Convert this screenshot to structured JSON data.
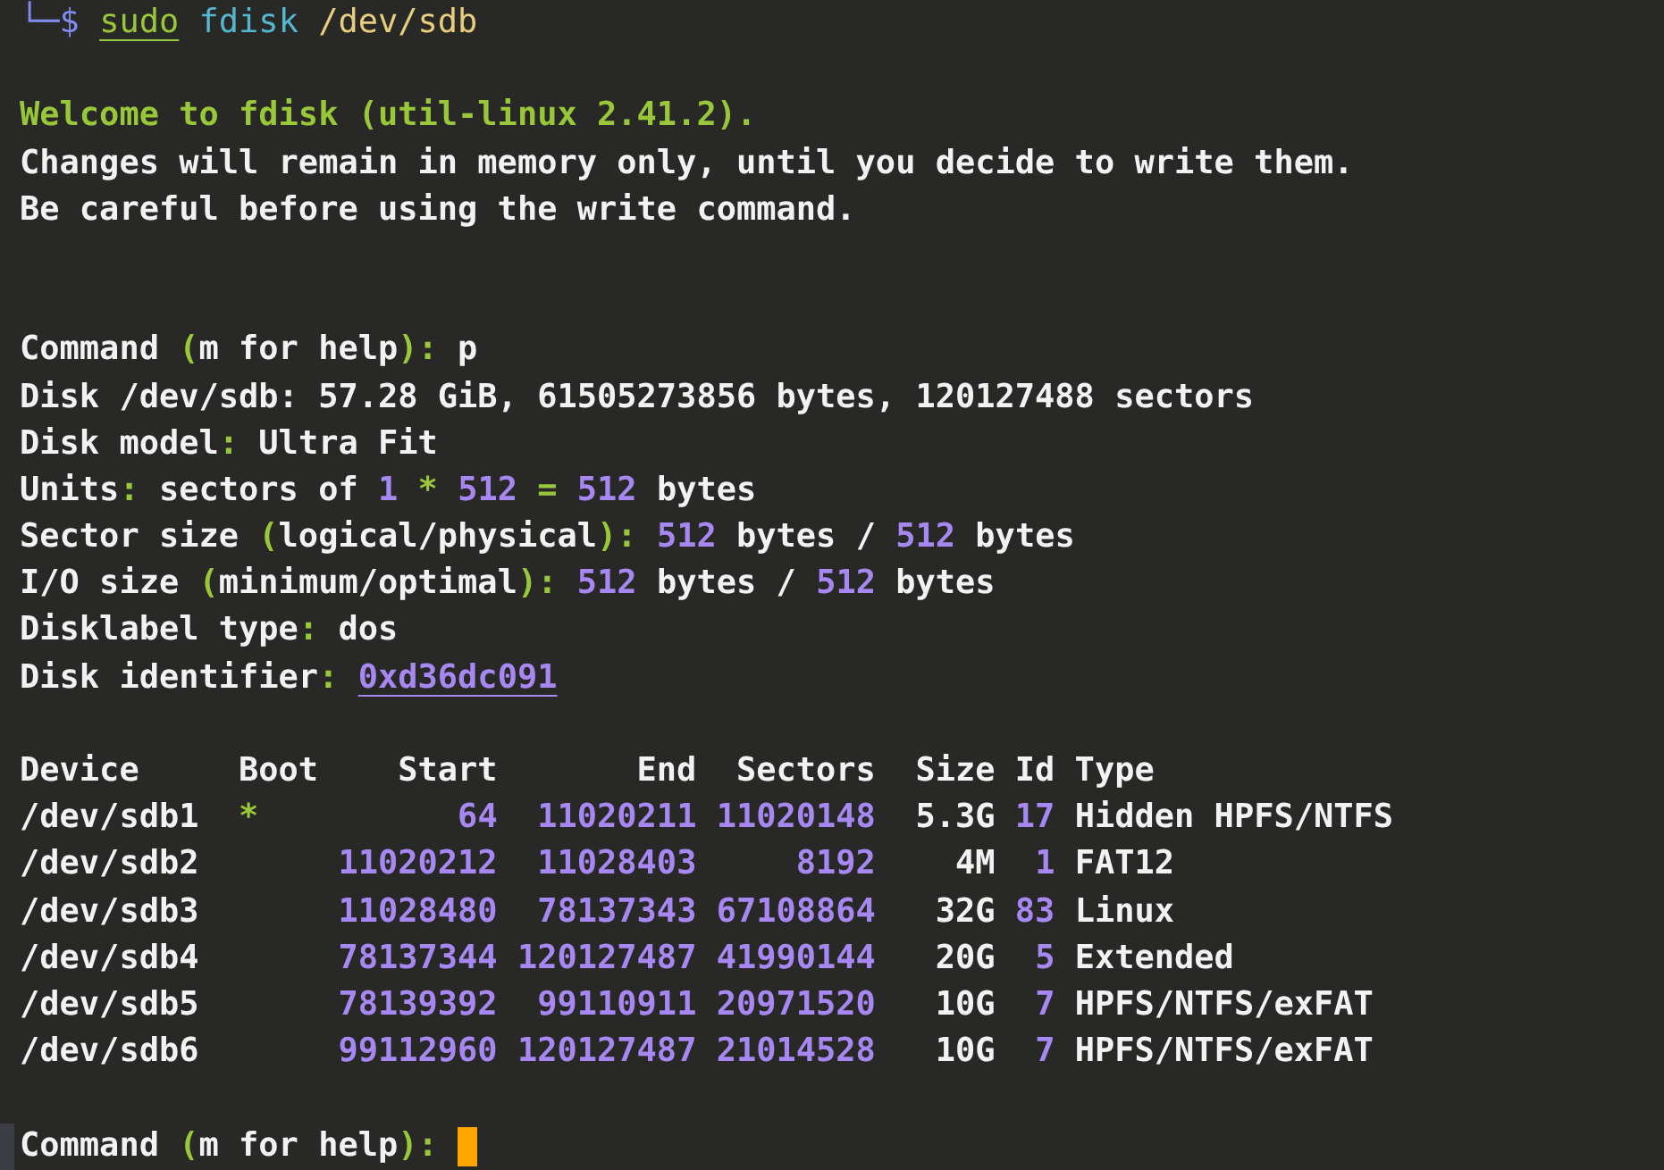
{
  "terminal": {
    "lines": [
      {
        "kind": "text",
        "segments": [
          {
            "text": "└─",
            "kind": "blue"
          },
          {
            "text": "$ ",
            "kind": "blue"
          },
          {
            "text": "sudo",
            "kind": "command"
          },
          {
            "text": " fdisk",
            "kind": "cyan"
          },
          {
            "text": " /dev/sdb",
            "kind": "yellow"
          }
        ]
      },
      {
        "kind": "blank"
      },
      {
        "kind": "text",
        "segments": [
          {
            "text": "Welcome to fdisk (util-linux 2.41.2).",
            "kind": "green"
          }
        ]
      },
      {
        "kind": "text",
        "segments": [
          {
            "text": "Changes will remain in memory only, until you decide to write them.",
            "kind": "plain"
          }
        ]
      },
      {
        "kind": "text",
        "segments": [
          {
            "text": "Be careful before using the write command.",
            "kind": "plain"
          }
        ]
      },
      {
        "kind": "blank"
      },
      {
        "kind": "blank"
      },
      {
        "kind": "text",
        "segments": [
          {
            "text": "Command ",
            "kind": "plain"
          },
          {
            "text": "(",
            "kind": "green"
          },
          {
            "text": "m for help",
            "kind": "plain"
          },
          {
            "text": "):",
            "kind": "green"
          },
          {
            "text": " p",
            "kind": "plain"
          }
        ]
      },
      {
        "kind": "text",
        "segments": [
          {
            "text": "Disk /dev/sdb: 57.28 GiB, 61505273856 bytes, 120127488 sectors",
            "kind": "plain"
          }
        ]
      },
      {
        "kind": "text",
        "segments": [
          {
            "text": "Disk model",
            "kind": "plain"
          },
          {
            "text": ":",
            "kind": "green"
          },
          {
            "text": " Ultra Fit",
            "kind": "plain"
          }
        ]
      },
      {
        "kind": "text",
        "segments": [
          {
            "text": "Units",
            "kind": "plain"
          },
          {
            "text": ":",
            "kind": "green"
          },
          {
            "text": " sectors of ",
            "kind": "plain"
          },
          {
            "text": "1",
            "kind": "purple"
          },
          {
            "text": " * ",
            "kind": "green"
          },
          {
            "text": "512",
            "kind": "purple"
          },
          {
            "text": " = ",
            "kind": "green"
          },
          {
            "text": "512",
            "kind": "purple"
          },
          {
            "text": " bytes",
            "kind": "plain"
          }
        ]
      },
      {
        "kind": "text",
        "segments": [
          {
            "text": "Sector size ",
            "kind": "plain"
          },
          {
            "text": "(",
            "kind": "green"
          },
          {
            "text": "logical/physical",
            "kind": "plain"
          },
          {
            "text": "): ",
            "kind": "green"
          },
          {
            "text": "512",
            "kind": "purple"
          },
          {
            "text": " bytes / ",
            "kind": "plain"
          },
          {
            "text": "512",
            "kind": "purple"
          },
          {
            "text": " bytes",
            "kind": "plain"
          }
        ]
      },
      {
        "kind": "text",
        "segments": [
          {
            "text": "I/O size ",
            "kind": "plain"
          },
          {
            "text": "(",
            "kind": "green"
          },
          {
            "text": "minimum/optimal",
            "kind": "plain"
          },
          {
            "text": "): ",
            "kind": "green"
          },
          {
            "text": "512",
            "kind": "purple"
          },
          {
            "text": " bytes / ",
            "kind": "plain"
          },
          {
            "text": "512",
            "kind": "purple"
          },
          {
            "text": " bytes",
            "kind": "plain"
          }
        ]
      },
      {
        "kind": "text",
        "segments": [
          {
            "text": "Disklabel type",
            "kind": "plain"
          },
          {
            "text": ":",
            "kind": "green"
          },
          {
            "text": " dos",
            "kind": "plain"
          }
        ]
      },
      {
        "kind": "text",
        "segments": [
          {
            "text": "Disk identifier",
            "kind": "plain"
          },
          {
            "text": ": ",
            "kind": "green"
          },
          {
            "text": "0xd36dc091",
            "kind": "link"
          }
        ]
      },
      {
        "kind": "blank"
      },
      {
        "kind": "text",
        "segments": [
          {
            "text": "Device     Boot    Start       End  Sectors  Size Id Type",
            "kind": "plain"
          }
        ]
      },
      {
        "kind": "text",
        "segments": [
          {
            "text": "/dev/sdb1  ",
            "kind": "plain"
          },
          {
            "text": "*",
            "kind": "green"
          },
          {
            "text": "          64  11020211 11020148",
            "kind": "purple"
          },
          {
            "text": "  5.3G ",
            "kind": "plain"
          },
          {
            "text": "17",
            "kind": "purple"
          },
          {
            "text": " Hidden HPFS/NTFS",
            "kind": "plain"
          }
        ]
      },
      {
        "kind": "text",
        "segments": [
          {
            "text": "/dev/sdb2       ",
            "kind": "plain"
          },
          {
            "text": "11020212  11028403     8192",
            "kind": "purple"
          },
          {
            "text": "    4M  ",
            "kind": "plain"
          },
          {
            "text": "1",
            "kind": "purple"
          },
          {
            "text": " FAT12",
            "kind": "plain"
          }
        ]
      },
      {
        "kind": "text",
        "segments": [
          {
            "text": "/dev/sdb3       ",
            "kind": "plain"
          },
          {
            "text": "11028480  78137343 67108864",
            "kind": "purple"
          },
          {
            "text": "   32G ",
            "kind": "plain"
          },
          {
            "text": "83",
            "kind": "purple"
          },
          {
            "text": " Linux",
            "kind": "plain"
          }
        ]
      },
      {
        "kind": "text",
        "segments": [
          {
            "text": "/dev/sdb4       ",
            "kind": "plain"
          },
          {
            "text": "78137344 120127487 41990144",
            "kind": "purple"
          },
          {
            "text": "   20G  ",
            "kind": "plain"
          },
          {
            "text": "5",
            "kind": "purple"
          },
          {
            "text": " Extended",
            "kind": "plain"
          }
        ]
      },
      {
        "kind": "text",
        "segments": [
          {
            "text": "/dev/sdb5       ",
            "kind": "plain"
          },
          {
            "text": "78139392  99110911 20971520",
            "kind": "purple"
          },
          {
            "text": "   10G  ",
            "kind": "plain"
          },
          {
            "text": "7",
            "kind": "purple"
          },
          {
            "text": " HPFS/NTFS/exFAT",
            "kind": "plain"
          }
        ]
      },
      {
        "kind": "text",
        "segments": [
          {
            "text": "/dev/sdb6       ",
            "kind": "plain"
          },
          {
            "text": "99112960 120127487 21014528",
            "kind": "purple"
          },
          {
            "text": "   10G  ",
            "kind": "plain"
          },
          {
            "text": "7",
            "kind": "purple"
          },
          {
            "text": " HPFS/NTFS/exFAT",
            "kind": "plain"
          }
        ]
      },
      {
        "kind": "blank"
      },
      {
        "kind": "text",
        "marked": true,
        "cursor": true,
        "segments": [
          {
            "text": "Command ",
            "kind": "plain"
          },
          {
            "text": "(",
            "kind": "green"
          },
          {
            "text": "m for help",
            "kind": "plain"
          },
          {
            "text": "): ",
            "kind": "green"
          }
        ]
      }
    ]
  }
}
